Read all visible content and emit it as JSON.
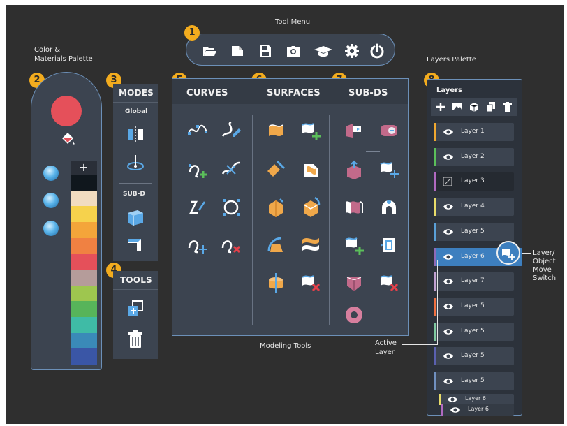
{
  "labels": {
    "tool_menu": "Tool Menu",
    "color_palette_line1": "Color &",
    "color_palette_line2": "Materials Palette",
    "layers_palette": "Layers Palette",
    "modeling_tools": "Modeling Tools",
    "active_layer_line1": "Active",
    "active_layer_line2": "Layer",
    "switch_line1": "Layer/",
    "switch_line2": "Object",
    "switch_line3": "Move",
    "switch_line4": "Switch"
  },
  "badges": [
    "1",
    "2",
    "3",
    "4",
    "5",
    "6",
    "7",
    "8"
  ],
  "toolbar": {
    "icons": [
      "folder-open-icon",
      "new-file-icon",
      "save-icon",
      "camera-icon",
      "graduation-cap-icon",
      "gear-icon",
      "power-icon"
    ]
  },
  "modes": {
    "title": "MODES",
    "global_label": "Global",
    "subd_label": "SUB-D",
    "icons": [
      "mirror-icon",
      "snap-icon",
      "subd-box-icon",
      "subd-crease-icon"
    ]
  },
  "tools": {
    "title": "TOOLS",
    "icons": [
      "duplicate-icon",
      "trash-icon"
    ]
  },
  "modeling": {
    "curves_title": "CURVES",
    "surfaces_title": "SURFACES",
    "subds_title": "SUB-DS"
  },
  "color_palette": {
    "current_color": "#e5505a",
    "add_label": "+",
    "swatches": [
      "#10171d",
      "#f1dcc0",
      "#f6d24c",
      "#f4a53a",
      "#f08142",
      "#e5505a",
      "#b59c9a",
      "#9ec64f",
      "#57b45a",
      "#3fbba6",
      "#3a8ab8",
      "#3a56a6"
    ]
  },
  "layers": {
    "title": "Layers",
    "toolbar_icons": [
      "add-layer-icon",
      "image-layer-icon",
      "layer-objects-icon",
      "copy-layer-icon",
      "delete-layer-icon"
    ],
    "items": [
      {
        "name": "Layer 1",
        "color": "#f0a830"
      },
      {
        "name": "Layer 2",
        "color": "#5bbf5a"
      },
      {
        "name": "Layer 3",
        "color": "#b069c0"
      },
      {
        "name": "Layer 4",
        "color": "#e8dc6a"
      },
      {
        "name": "Layer 5",
        "color": "#5aa0d8"
      },
      {
        "name": "Layer 6",
        "color": "#8e6ab8"
      },
      {
        "name": "Layer 7",
        "color": "#c0a0d0"
      },
      {
        "name": "Layer 5",
        "color": "#f07040"
      },
      {
        "name": "Layer 5",
        "color": "#7ec8a0"
      },
      {
        "name": "Layer 5",
        "color": "#5a60b0"
      },
      {
        "name": "Layer 5",
        "color": "#7090c0"
      }
    ],
    "stack_names": [
      "Layer 6",
      "Layer 6"
    ]
  },
  "colors": {
    "accent": "#f3ac1e",
    "panel": "#3c4450",
    "outline": "#6c90b8",
    "active_layer": "#3d7fbf",
    "tool_orange": "#f0a84a",
    "tool_blue": "#5aa8e6"
  }
}
